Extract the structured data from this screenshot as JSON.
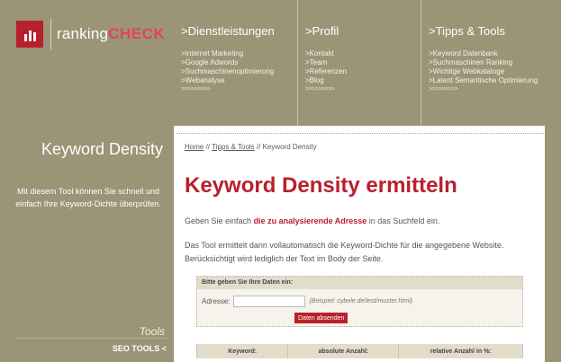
{
  "logo": {
    "text_part": "ranking",
    "brand_part": "CHECK"
  },
  "sidebar": {
    "title": "Keyword Density",
    "description": "Mit diesem Tool können Sie schnell und einfach Ihre Keyword-Dichte überprüfen.",
    "section_label": "Tools",
    "seo_tools": "SEO TOOLS <"
  },
  "nav": {
    "dienstleistungen": {
      "title": ">Dienstleistungen",
      "items": [
        ">Internet Marketing",
        ">Google Adwords",
        ">Suchmaschinenoptimierung",
        ">Webanalyse"
      ],
      "more": ">>>>>>>>>"
    },
    "profil": {
      "title": ">Profil",
      "items": [
        ">Kontakt",
        ">Team",
        ">Referenzen",
        ">Blog"
      ],
      "more": ">>>>>>>>>"
    },
    "tipps": {
      "title": ">Tipps & Tools",
      "items": [
        ">Keyword Datenbank",
        ">Suchmaschinen Ranking",
        ">Wichtige Webkataloge",
        ">Latent Semantische Optimierung"
      ],
      "more": ">>>>>>>>>"
    }
  },
  "breadcrumb": {
    "home": "Home",
    "sep1": " // ",
    "tipps": "Tipps & Tools",
    "sep2": " // ",
    "current": "Keyword Density"
  },
  "main": {
    "title": "Keyword Density ermitteln",
    "p1_before": "Geben Sie einfach ",
    "p1_bold": "die zu analysierende Adresse",
    "p1_after": " in das Suchfeld ein.",
    "p2": "Das Tool ermittelt dann vollautomatisch die Keyword-Dichte für die angegebene Website. Berücksichtigt wird lediglich der Text im Body der Seite."
  },
  "form": {
    "heading": "Bitte geben Sie Ihre Daten ein:",
    "address_label": "Adresse:",
    "address_value": "",
    "hint": "(Beispiel: cybele.de/test/muster.html)",
    "submit": "Daten absenden"
  },
  "table": {
    "headers": [
      "Keyword:",
      "absolute Anzahl:",
      "relative Anzahl in %:"
    ]
  }
}
